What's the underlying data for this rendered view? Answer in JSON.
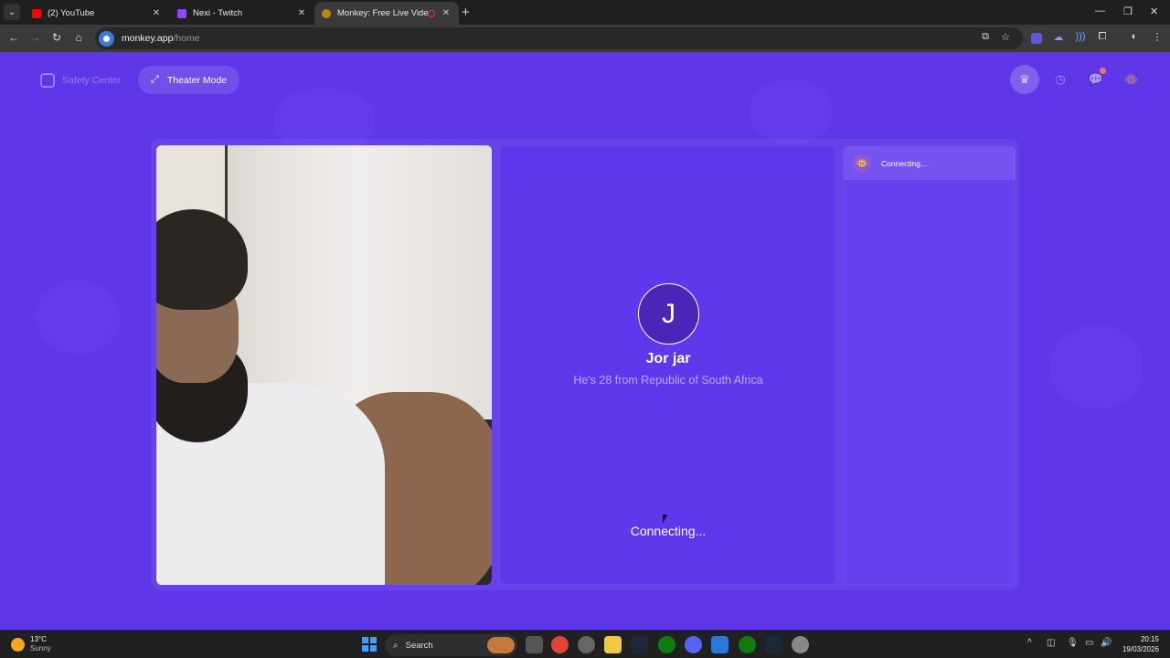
{
  "browser": {
    "tabs": [
      {
        "title": "(2) YouTube",
        "favicon_color": "#ff0000",
        "active": false
      },
      {
        "title": "Nexi - Twitch",
        "favicon_color": "#9146ff",
        "active": false
      },
      {
        "title": "Monkey: Free Live Video Ch",
        "favicon_color": "#b8860b",
        "active": true,
        "recording": true
      }
    ],
    "new_tab_label": "+",
    "url_host": "monkey.app",
    "url_path": "/home"
  },
  "header": {
    "safety_label": "Safety Center",
    "theater_label": "Theater Mode",
    "notification_count": ""
  },
  "self_video": {
    "label": ""
  },
  "peer": {
    "initial": "J",
    "name": "Jor jar",
    "info": "He's 28 from Republic of South Africa",
    "status": "Connecting..."
  },
  "chat": {
    "status": "Connecting...",
    "icon": "monkey-icon"
  },
  "taskbar": {
    "temperature": "13°C",
    "weather": "Sunny",
    "search_label": "Search",
    "time": "20:15",
    "date": "19/03/2026"
  },
  "colors": {
    "brand_purple": "#5f37e8",
    "avatar_bg": "#4b25b8"
  }
}
